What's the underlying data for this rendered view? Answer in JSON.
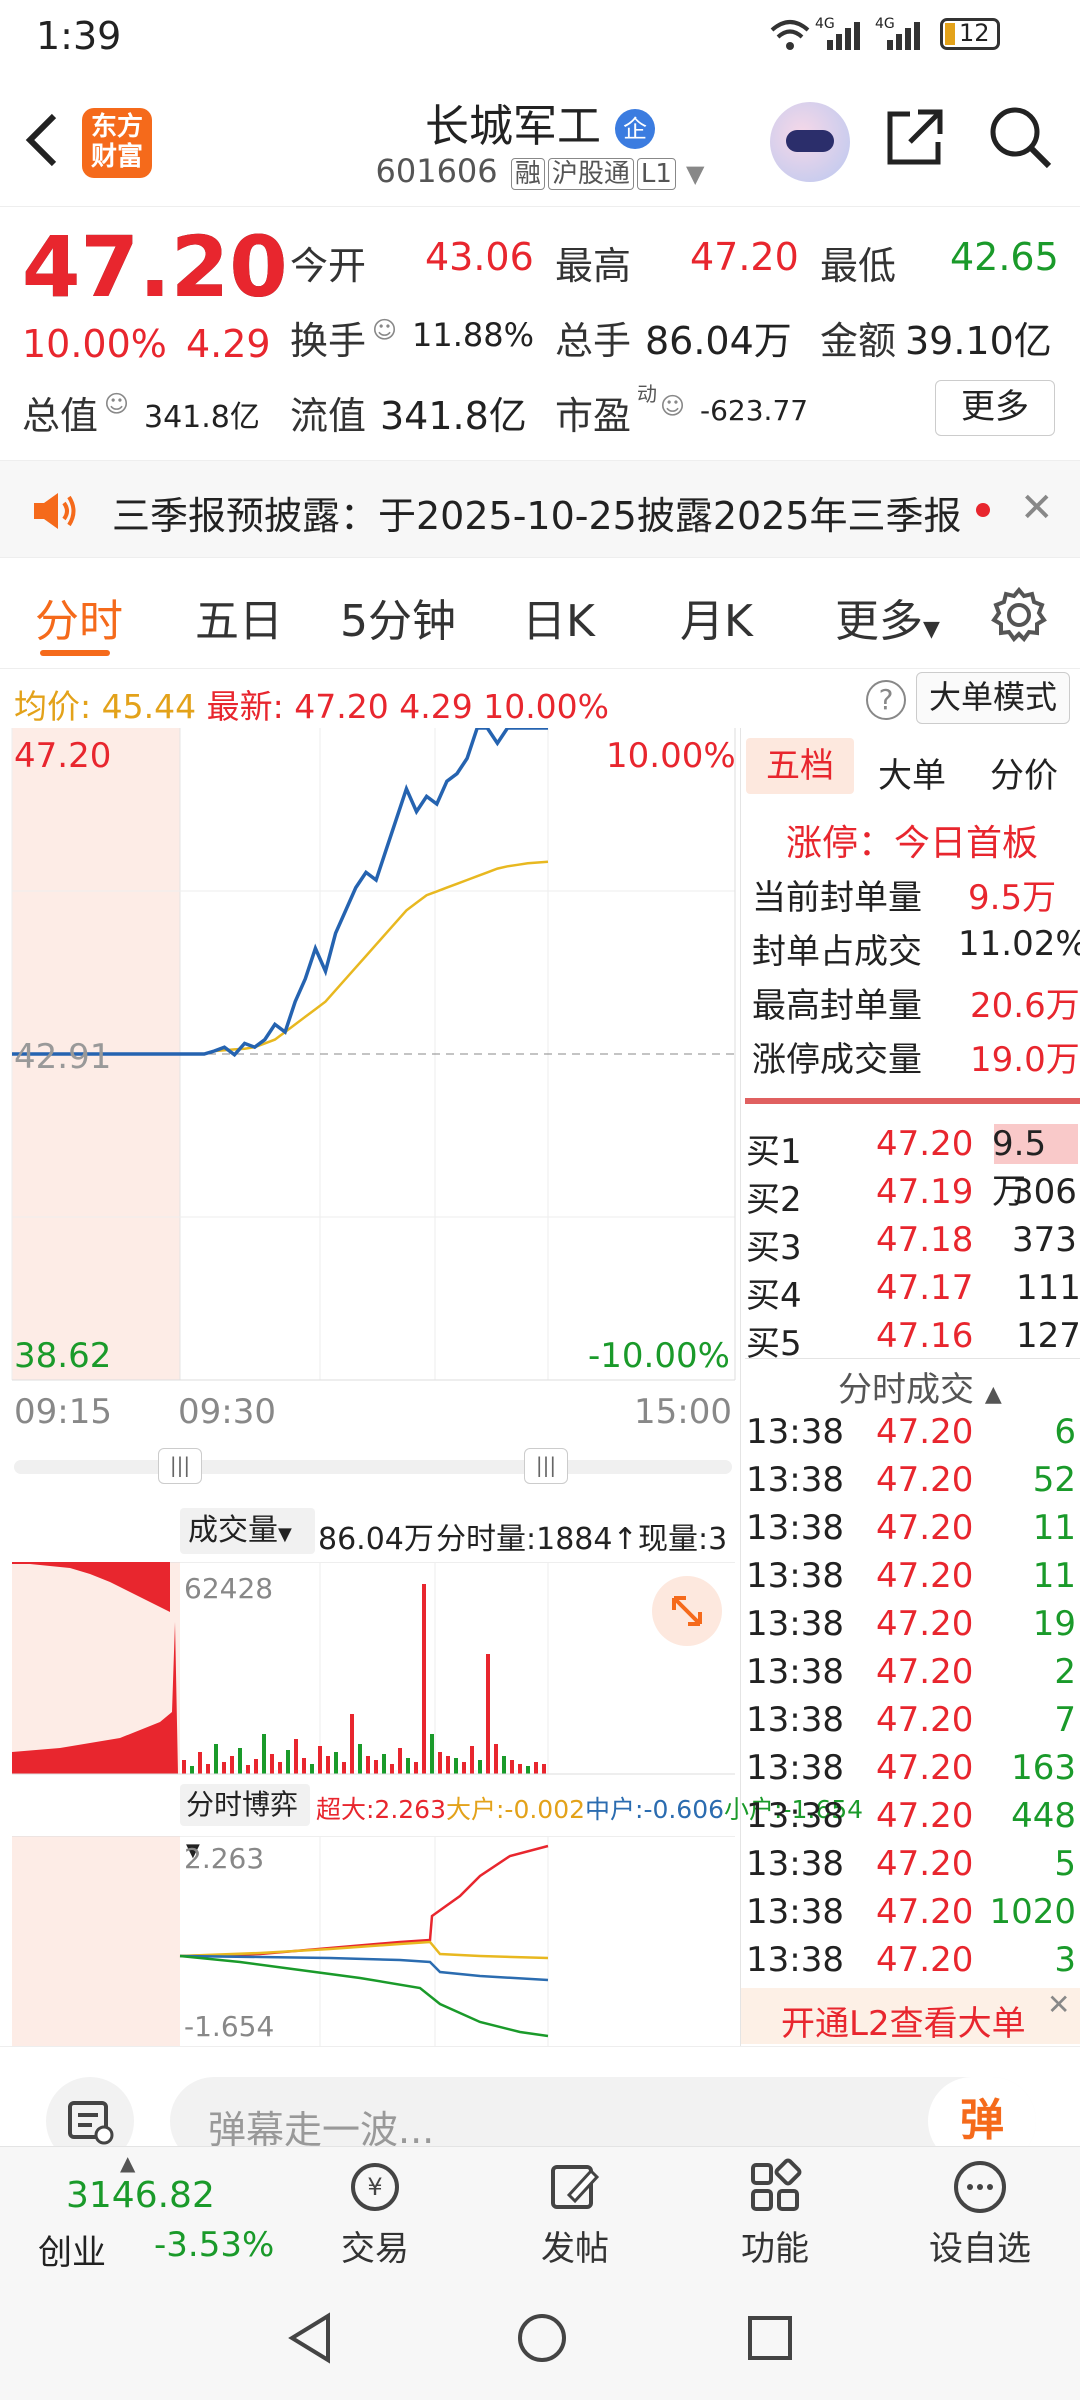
{
  "status": {
    "time": "1:39",
    "battery": "12",
    "net1": "4G",
    "net2": "4G"
  },
  "nav": {
    "logo_line1": "东方",
    "logo_line2": "财富",
    "title": "长城军工",
    "badge": "企",
    "code": "601606",
    "tags": [
      "融",
      "沪股通",
      "L1"
    ]
  },
  "quote": {
    "price": "47.20",
    "pct": "10.00%",
    "change": "4.29",
    "open_label": "今开",
    "open": "43.06",
    "high_label": "最高",
    "high": "47.20",
    "low_label": "最低",
    "low": "42.65",
    "turnover_label": "换手",
    "turnover": "11.88%",
    "volume_label": "总手",
    "volume": "86.04万",
    "amount_label": "金额",
    "amount": "39.10亿",
    "mcap_label": "总值",
    "mcap": "341.8亿",
    "float_label": "流值",
    "float": "341.8亿",
    "pe_label": "市盈",
    "pe_sup": "动",
    "pe": "-623.77",
    "more": "更多"
  },
  "notice": {
    "text": "三季报预披露：于2025-10-25披露2025年三季报"
  },
  "tabs": [
    "分时",
    "五日",
    "5分钟",
    "日K",
    "月K",
    "更多"
  ],
  "chart_info": {
    "avg_label": "均价:",
    "avg": "45.44",
    "latest_label": "最新:",
    "latest": "47.20",
    "change": "4.29",
    "pct": "10.00%",
    "big_order_mode": "大单模式"
  },
  "chart_data": {
    "type": "line",
    "y_top": "47.20",
    "y_mid": "42.91",
    "y_bottom": "38.62",
    "pct_top": "10.00%",
    "pct_bottom": "-10.00%",
    "x_labels": [
      "09:15",
      "09:30",
      "15:00"
    ],
    "ylim": [
      38.62,
      47.2
    ],
    "price_series": [
      42.91,
      42.91,
      42.91,
      42.91,
      42.91,
      42.91,
      42.91,
      42.91,
      42.91,
      42.91,
      42.91,
      42.91,
      42.91,
      42.91,
      42.91,
      42.91,
      42.91,
      42.91,
      42.91,
      42.91,
      42.95,
      43.0,
      42.9,
      43.05,
      43.0,
      43.1,
      43.3,
      43.2,
      43.6,
      43.9,
      44.3,
      44.0,
      44.5,
      44.8,
      45.1,
      45.3,
      45.2,
      45.6,
      46.0,
      46.4,
      46.1,
      46.3,
      46.2,
      46.5,
      46.6,
      46.8,
      47.2,
      47.2,
      47.0,
      47.2,
      47.2,
      47.2,
      47.2,
      47.2
    ],
    "avg_series": [
      null,
      null,
      null,
      null,
      null,
      null,
      null,
      null,
      null,
      null,
      null,
      null,
      null,
      null,
      null,
      null,
      null,
      null,
      null,
      null,
      42.95,
      42.96,
      42.97,
      42.98,
      43.0,
      43.05,
      43.1,
      43.2,
      43.3,
      43.4,
      43.5,
      43.6,
      43.75,
      43.9,
      44.05,
      44.2,
      44.35,
      44.5,
      44.65,
      44.8,
      44.9,
      45.0,
      45.05,
      45.1,
      45.15,
      45.2,
      45.25,
      45.3,
      45.35,
      45.38,
      45.4,
      45.42,
      45.43,
      45.44
    ]
  },
  "volume": {
    "label": "成交量",
    "total": "86.04万",
    "minute_label": "分时量:1884↑",
    "current_label": "现量:3",
    "max_label": "62428"
  },
  "flow": {
    "label": "分时博弈",
    "super_label": "超大:2.263",
    "big_label": "大户:-0.002",
    "mid_label": "中户:-0.606",
    "small_label": "小户:-1.654",
    "top": "2.263",
    "bottom": "-1.654"
  },
  "side": {
    "tabs": [
      "五档",
      "大单",
      "分价"
    ],
    "limit_title": "涨停：今日首板",
    "stats": [
      {
        "label": "当前封单量",
        "value": "9.5万"
      },
      {
        "label": "封单占成交",
        "value": "11.02%"
      },
      {
        "label": "最高封单量",
        "value": "20.6万"
      },
      {
        "label": "涨停成交量",
        "value": "19.0万"
      }
    ],
    "bids": [
      {
        "label": "买1",
        "price": "47.20",
        "vol": "9.5万"
      },
      {
        "label": "买2",
        "price": "47.19",
        "vol": "306"
      },
      {
        "label": "买3",
        "price": "47.18",
        "vol": "373"
      },
      {
        "label": "买4",
        "price": "47.17",
        "vol": "111"
      },
      {
        "label": "买5",
        "price": "47.16",
        "vol": "127"
      }
    ],
    "trades_title": "分时成交",
    "trades": [
      {
        "t": "13:38",
        "p": "47.20",
        "v": "6"
      },
      {
        "t": "13:38",
        "p": "47.20",
        "v": "52"
      },
      {
        "t": "13:38",
        "p": "47.20",
        "v": "11"
      },
      {
        "t": "13:38",
        "p": "47.20",
        "v": "11"
      },
      {
        "t": "13:38",
        "p": "47.20",
        "v": "19"
      },
      {
        "t": "13:38",
        "p": "47.20",
        "v": "2"
      },
      {
        "t": "13:38",
        "p": "47.20",
        "v": "7"
      },
      {
        "t": "13:38",
        "p": "47.20",
        "v": "163"
      },
      {
        "t": "13:38",
        "p": "47.20",
        "v": "448"
      },
      {
        "t": "13:38",
        "p": "47.20",
        "v": "5"
      },
      {
        "t": "13:38",
        "p": "47.20",
        "v": "1020"
      },
      {
        "t": "13:38",
        "p": "47.20",
        "v": "3"
      }
    ],
    "l2_banner": "开通L2查看大单"
  },
  "comment": {
    "placeholder": "弹幕走一波...",
    "danmu": "弹"
  },
  "bottom": {
    "index_value": "3146.82",
    "index_name": "创业",
    "index_pct": "-3.53%",
    "items": [
      "交易",
      "发帖",
      "功能",
      "设自选"
    ]
  }
}
